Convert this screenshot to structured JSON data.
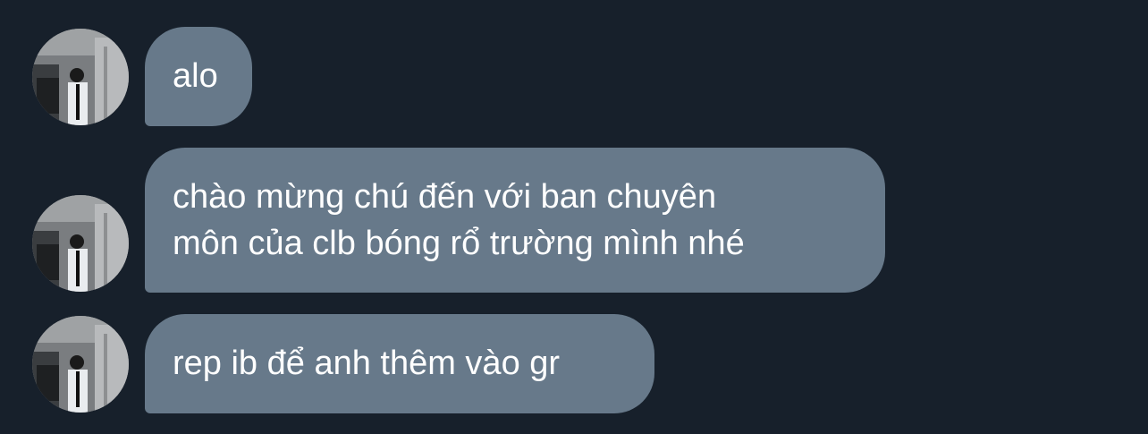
{
  "messages": [
    {
      "lines": [
        "alo"
      ]
    },
    {
      "lines": [
        "chào mừng chú đến với ban chuyên",
        "môn của clb bóng rổ trường mình nhé"
      ]
    },
    {
      "lines": [
        "rep ib để anh thêm vào gr"
      ]
    }
  ],
  "colors": {
    "background": "#17202b",
    "bubble": "#67798a",
    "text": "#ffffff"
  }
}
